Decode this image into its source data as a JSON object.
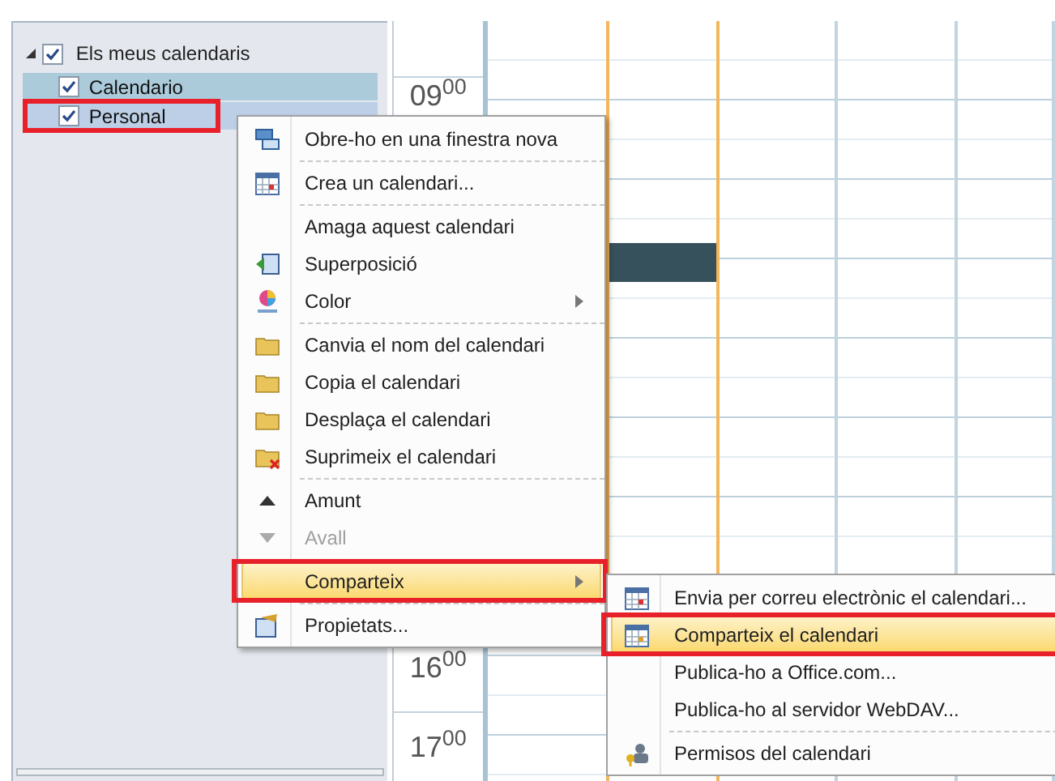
{
  "calendar_tree": {
    "group": {
      "label": "Els meus calendaris",
      "expanded": true,
      "checked": true
    },
    "items": [
      {
        "label": "Calendario",
        "checked": true,
        "selected": true,
        "outlined": false
      },
      {
        "label": "Personal",
        "checked": true,
        "selected": false,
        "outlined": true
      }
    ]
  },
  "time_labels": [
    {
      "text": "09$^{00}$"
    },
    {
      "text": "16$^{00}$"
    },
    {
      "text": "17$^{00}$"
    }
  ],
  "context_menu": {
    "items": [
      {
        "label": "Obre-ho en una finestra nova",
        "kind": "window",
        "separator_after": true,
        "submenu": false,
        "disabled": false,
        "selected": false,
        "outlined": false
      },
      {
        "label": "Crea un calendari...",
        "kind": "newcal",
        "separator_after": true,
        "submenu": false,
        "disabled": false,
        "selected": false,
        "outlined": false
      },
      {
        "label": "Amaga aquest calendari",
        "kind": "plain",
        "separator_after": false,
        "submenu": false,
        "disabled": false,
        "selected": false,
        "outlined": false
      },
      {
        "label": "Superposició",
        "kind": "overlay",
        "separator_after": false,
        "submenu": false,
        "disabled": false,
        "selected": false,
        "outlined": false
      },
      {
        "label": "Color",
        "kind": "color",
        "separator_after": true,
        "submenu": true,
        "disabled": false,
        "selected": false,
        "outlined": false
      },
      {
        "label": "Canvia el nom del calendari",
        "kind": "rename",
        "separator_after": false,
        "submenu": false,
        "disabled": false,
        "selected": false,
        "outlined": false
      },
      {
        "label": "Copia el calendari",
        "kind": "copy",
        "separator_after": false,
        "submenu": false,
        "disabled": false,
        "selected": false,
        "outlined": false
      },
      {
        "label": "Desplaça el calendari",
        "kind": "move",
        "separator_after": false,
        "submenu": false,
        "disabled": false,
        "selected": false,
        "outlined": false
      },
      {
        "label": "Suprimeix el calendari",
        "kind": "delete",
        "separator_after": true,
        "submenu": false,
        "disabled": false,
        "selected": false,
        "outlined": false
      },
      {
        "label": "Amunt",
        "kind": "up",
        "separator_after": false,
        "submenu": false,
        "disabled": false,
        "selected": false,
        "outlined": false
      },
      {
        "label": "Avall",
        "kind": "down",
        "separator_after": true,
        "submenu": false,
        "disabled": true,
        "selected": false,
        "outlined": false
      },
      {
        "label": "Comparteix",
        "kind": "plain",
        "separator_after": true,
        "submenu": true,
        "disabled": false,
        "selected": true,
        "outlined": true
      },
      {
        "label": "Propietats...",
        "kind": "props",
        "separator_after": false,
        "submenu": false,
        "disabled": false,
        "selected": false,
        "outlined": false
      }
    ]
  },
  "submenu": {
    "items": [
      {
        "label": "Envia per correu electrònic el calendari...",
        "kind": "mailcal",
        "separator_after": false,
        "selected": false,
        "outlined": false
      },
      {
        "label": "Comparteix el calendari",
        "kind": "sharecal",
        "separator_after": false,
        "selected": true,
        "outlined": true
      },
      {
        "label": "Publica-ho a Office.com...",
        "kind": "plain",
        "separator_after": false,
        "selected": false,
        "outlined": false
      },
      {
        "label": "Publica-ho al servidor WebDAV...",
        "kind": "plain",
        "separator_after": true,
        "selected": false,
        "outlined": false
      },
      {
        "label": "Permisos del calendari",
        "kind": "perms",
        "separator_after": false,
        "selected": false,
        "outlined": false
      }
    ]
  }
}
